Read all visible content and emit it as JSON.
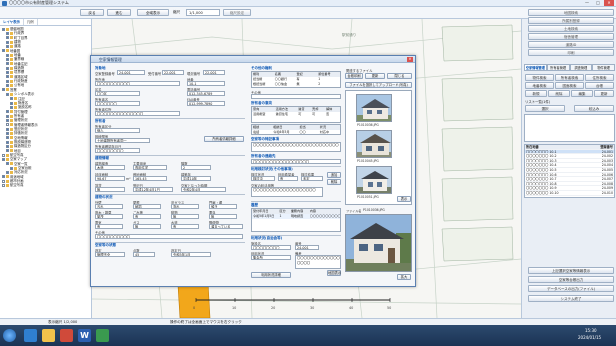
{
  "window": {
    "title": "〇〇〇〇市公有財産管理システム",
    "min": "—",
    "max": "□",
    "close": "✕"
  },
  "toolbar": {
    "buttons": [
      "戻る",
      "進む",
      "全域表示"
    ],
    "scale_label": "縮尺",
    "scale_value": "1/1,000",
    "scale_reset": "縮尺設定",
    "right_buttons": [
      "地図検索",
      "所属別登録",
      "土地検索",
      "宿舎管理",
      "道路ID",
      "印刷"
    ]
  },
  "sidebar": {
    "tabs": [
      "レイヤ表示",
      "凡例"
    ],
    "items": [
      {
        "label": "基盤地図",
        "depth": 0,
        "checked": true
      },
      {
        "label": "行政界",
        "depth": 1,
        "checked": true
      },
      {
        "label": "町丁目界",
        "depth": 1,
        "checked": true
      },
      {
        "label": "建物",
        "depth": 1,
        "checked": true
      },
      {
        "label": "道路",
        "depth": 1,
        "checked": true
      },
      {
        "label": "地番図",
        "depth": 0,
        "checked": true
      },
      {
        "label": "地番",
        "depth": 1,
        "checked": true
      },
      {
        "label": "筆界線",
        "depth": 1,
        "checked": true
      },
      {
        "label": "地番注記",
        "depth": 1,
        "checked": true
      },
      {
        "label": "構造物",
        "depth": 1,
        "checked": true
      },
      {
        "label": "境界標",
        "depth": 1,
        "checked": true
      },
      {
        "label": "道路区域",
        "depth": 1,
        "checked": true
      },
      {
        "label": "行政財産",
        "depth": 1,
        "checked": true
      },
      {
        "label": "公有地",
        "depth": 1,
        "checked": true
      },
      {
        "label": "営業",
        "depth": 0,
        "checked": true
      },
      {
        "label": "シンボル表示",
        "depth": 1,
        "checked": true
      },
      {
        "label": "注記",
        "depth": 2,
        "checked": true
      },
      {
        "label": "財産名",
        "depth": 2,
        "checked": true
      },
      {
        "label": "施設名称",
        "depth": 2,
        "checked": true
      },
      {
        "label": "貸付管理",
        "depth": 1,
        "checked": true
      },
      {
        "label": "所有者",
        "depth": 1,
        "checked": true
      },
      {
        "label": "管理状況",
        "depth": 1,
        "checked": true
      },
      {
        "label": "管理者情報表示",
        "depth": 1,
        "checked": false
      },
      {
        "label": "登記状況",
        "depth": 1,
        "checked": true
      },
      {
        "label": "評価状況",
        "depth": 1,
        "checked": true
      },
      {
        "label": "空地情報",
        "depth": 1,
        "checked": true
      },
      {
        "label": "既設構造物",
        "depth": 1,
        "checked": true
      },
      {
        "label": "構造物区分",
        "depth": 1,
        "checked": true
      },
      {
        "label": "地目",
        "depth": 1,
        "checked": true
      },
      {
        "label": "航空写真",
        "depth": 0,
        "checked": false
      },
      {
        "label": "空家マップ",
        "depth": 0,
        "checked": true
      },
      {
        "label": "空家一覧",
        "depth": 1,
        "checked": true
      },
      {
        "label": "空家台帳",
        "depth": 2,
        "checked": true
      },
      {
        "label": "対応状況",
        "depth": 1,
        "checked": true
      },
      {
        "label": "用途地域",
        "depth": 0,
        "checked": true
      },
      {
        "label": "都市計画",
        "depth": 0,
        "checked": false
      },
      {
        "label": "航空写真",
        "depth": 0,
        "checked": false
      }
    ]
  },
  "map": {
    "label": "駅前通り"
  },
  "right_panel": {
    "row_buttons": [
      "物件検索",
      "所有者検索",
      "住所検索",
      "地番検索",
      "図面検索",
      "台帳"
    ],
    "tabs": [
      "空家情報管理",
      "所有者管理",
      "調査管理",
      "物件管理"
    ],
    "action_buttons": [
      "新規",
      "削除",
      "編集",
      "更新"
    ],
    "list_label": "リスト一覧(1件)",
    "list_btn_a": "選択",
    "list_btn_b": "絞込み",
    "list_headers": [
      "所在地番",
      "登録番号"
    ],
    "list_rows": [
      [
        "〇〇〇〇〇〇〇 10-1",
        "24-001"
      ],
      [
        "〇〇〇〇〇〇〇 10-2",
        "24-002"
      ],
      [
        "〇〇〇〇〇〇〇 10-3",
        "24-003"
      ],
      [
        "〇〇〇〇〇〇〇 10-4",
        "24-004"
      ],
      [
        "〇〇〇〇〇〇〇 10-5",
        "24-005"
      ],
      [
        "〇〇〇〇〇〇〇 10-6",
        "24-006"
      ],
      [
        "〇〇〇〇〇〇〇 10-7",
        "24-007"
      ],
      [
        "〇〇〇〇〇〇〇 10-8",
        "24-008"
      ],
      [
        "〇〇〇〇〇〇〇 10-9",
        "24-009"
      ],
      [
        "〇〇〇〇〇〇〇 10-10",
        "24-010"
      ]
    ],
    "bottom_buttons": [
      "上記選択空家等情報表示",
      "空家等台帳出力",
      "データベースの出力(ファイル)",
      "システム終了"
    ]
  },
  "dialog": {
    "title": "空家情報管理",
    "close": "✕",
    "left": {
      "s1": "対象地",
      "l_reg": "空家登録番号",
      "v_reg": "24-001",
      "l_rec": "受付番号",
      "v_rec": "22-001",
      "l_rec2": "現況番号",
      "v_rec2": "22-001",
      "l_addr": "所在地",
      "v_addr": "〇〇〇〇〇〇〇〇〇〇",
      "l_lot": "地番",
      "v_lot": "10-1",
      "l_ward": "区名",
      "v_ward": "〇〇区",
      "l_tel": "電話番号",
      "v_tel": "012-345-6789",
      "l_fax": "FAX番号",
      "v_fax": "012-999-7890",
      "l_owner": "所有者名",
      "v_owner": "〇〇〇〇〇〇",
      "l_oaddr": "所有者住所",
      "v_oaddr": "〇〇〇〇〇〇〇〇〇〇〇〇〇〇",
      "s2": "所有者",
      "l_owner_type": "所有者区分",
      "v_owner_type": "個人",
      "l_heir": "相続関係",
      "v_heir": "土地建物所有者同一",
      "owner_btn": "所有者情報詳細",
      "l_reldate": "所有者確認年月日",
      "v_reldate": "〇〇〇〇〇〇〇〇",
      "s3": "建物情報",
      "l_str": "建物構造",
      "v_str": "木造",
      "l_use": "主要用途",
      "v_use": "専用住宅",
      "l_floors": "階数",
      "v_floors": "2",
      "l_area": "延床面積",
      "v_area": "98.67",
      "l_site": "敷地面積",
      "v_site": "165.45",
      "l_year": "建築年",
      "v_year": "平成10年",
      "l_unit": "m²",
      "l_rent": "賃貸",
      "v_rent": "無",
      "l_date": "登記日",
      "v_date": "平成12年4月1日",
      "l_since": "空家となった時期",
      "v_since": "令和2年4月",
      "s4": "建物の状況",
      "l_outer": "外壁",
      "v_outer": "汚れ",
      "l_roof": "屋根",
      "v_roof": "破損",
      "l_window": "窓ガラス",
      "v_window": "割れ",
      "l_gate": "門扉・塀",
      "v_gate": "傾き",
      "l_garden": "庭木・雑草",
      "v_garden": "繁茂",
      "l_trash": "ごみ等",
      "v_trash": "有",
      "l_animal": "動物",
      "v_animal": "無",
      "l_smell": "悪臭",
      "v_smell": "無",
      "l_elec": "電気",
      "v_elec": "有",
      "l_gas": "ガス",
      "v_gas": "無",
      "l_water": "水道",
      "v_water": "有",
      "l_mail": "郵便物",
      "v_mail": "溜まっている",
      "l_other": "その他",
      "v_other": "〇〇〇〇〇〇〇〇〇〇",
      "s5": "空家等の状態",
      "l_level": "判定",
      "v_level": "管理不全",
      "l_point": "点数",
      "v_point": "45",
      "l_judge": "判定日",
      "v_judge": "令和5年1月"
    },
    "mid": {
      "s1": "その他の権利",
      "h_cols": [
        "権利",
        "名義",
        "登記",
        "順位番号"
      ],
      "r1": [
        "抵当権",
        "〇〇銀行",
        "有",
        "1"
      ],
      "r2": [
        "根抵当権",
        "〇〇信金",
        "無",
        "2"
      ],
      "l_rights_note": "その他",
      "s2": "所有者の意向",
      "h2_cols": [
        "意向",
        "活用方法",
        "賃貸",
        "売却",
        "解体"
      ],
      "r3": [
        "活用希望",
        "賃貸住宅",
        "可",
        "可",
        "否"
      ],
      "r4": [
        "",
        "",
        "",
        "",
        ""
      ],
      "h3_cols": [
        "相談",
        "相談日",
        "担当",
        "状況"
      ],
      "r5": [
        "電話",
        "令和4年5月",
        "〇〇",
        "対応中"
      ],
      "s3": "空家等の特記事項",
      "v_note1": "〇〇〇〇〇〇〇〇〇〇〇〇〇〇〇〇〇〇〇〇〇〇〇〇〇〇",
      "s4": "所有者の連絡先",
      "v_note2": "〇〇〇〇〇〇〇〇〇〇〇〇〇〇〇〇〇",
      "s5": "利用検討状況(その他事項)",
      "l_sel1": "検討状況",
      "v_sel1": "検討中",
      "l_sel2": "利用希望者",
      "v_sel2": "有",
      "l_sel3": "検討結果",
      "v_sel3": "未定",
      "btn_a": "追加",
      "btn_b": "削除",
      "l_sub": "空家の利活用等",
      "v_sub": "〇〇〇〇〇〇〇〇〇〇〇〇〇〇〇〇〇〇〇",
      "s6": "履歴",
      "h4_cols": [
        "受付年月日",
        "区分",
        "業務内容",
        "内容"
      ],
      "r6": [
        "令和5年1月5日",
        "1",
        "現地調査",
        "〇〇〇〇〇〇〇〇〇〇"
      ],
      "s7": "利用状況(自治会等)",
      "l_fac": "施設名",
      "v_fac": "〇〇〇〇〇〇〇〇",
      "l_num": "番号",
      "v_num": "24-001",
      "l_use": "利用状況",
      "v_use": "集会所",
      "l_memo": "備考",
      "v_memo": "〇〇〇〇〇〇〇〇〇〇〇〇〇〇〇〇〇",
      "btn_c": "地図表示",
      "btn_d": "利用状況詳細"
    },
    "right": {
      "s1": "関連するファイル",
      "btn_print": "台帳印刷",
      "btn_update": "更新",
      "btn_close": "閉じる",
      "btn_file": "ファイルを選択してアップロード(写真)",
      "photo_a": "P1010036.JPG",
      "photo_b": "P1010045.JPG",
      "photo_c": "P1010051.JPG",
      "btn_show": "表示",
      "big_label": "ファイル名",
      "big_value": "P1010036.JPG",
      "big_btn": "拡大"
    }
  },
  "status": {
    "left": "表示縮尺 1/2,000",
    "mid": "操作の終了は全画面上でマウスを右クリック"
  },
  "taskbar": {
    "clock_time": "15:30",
    "clock_date": "2024/01/15"
  }
}
